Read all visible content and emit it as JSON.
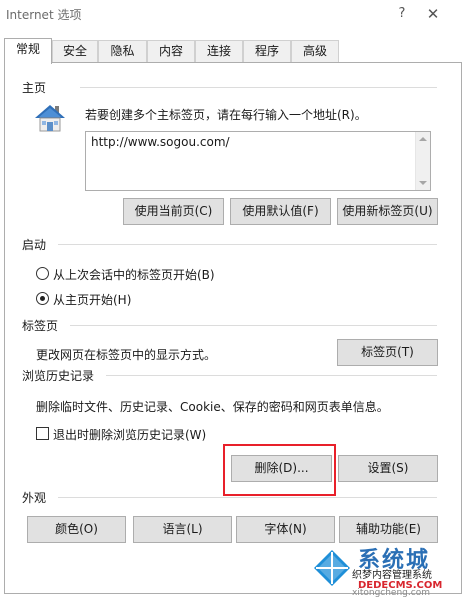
{
  "window": {
    "title": "Internet 选项",
    "help_label": "?",
    "close_label": "✕"
  },
  "tabs": [
    {
      "label": "常规",
      "active": true
    },
    {
      "label": "安全"
    },
    {
      "label": "隐私"
    },
    {
      "label": "内容"
    },
    {
      "label": "连接"
    },
    {
      "label": "程序"
    },
    {
      "label": "高级"
    }
  ],
  "homepage": {
    "section_label": "主页",
    "instruction": "若要创建多个主标签页，请在每行输入一个地址(R)。",
    "url_value": "http://www.sogou.com/",
    "use_current_label": "使用当前页(C)",
    "use_default_label": "使用默认值(F)",
    "use_new_tab_label": "使用新标签页(U)"
  },
  "startup": {
    "section_label": "启动",
    "option_last_session": "从上次会话中的标签页开始(B)",
    "option_home_page": "从主页开始(H)",
    "selected": "option_home_page"
  },
  "tabs_section": {
    "section_label": "标签页",
    "description": "更改网页在标签页中的显示方式。",
    "tabs_button_label": "标签页(T)"
  },
  "history": {
    "section_label": "浏览历史记录",
    "description": "删除临时文件、历史记录、Cookie、保存的密码和网页表单信息。",
    "delete_on_exit_label": "退出时删除浏览历史记录(W)",
    "delete_on_exit_checked": false,
    "delete_button_label": "删除(D)...",
    "settings_button_label": "设置(S)"
  },
  "appearance": {
    "section_label": "外观",
    "colors_label": "颜色(O)",
    "languages_label": "语言(L)",
    "fonts_label": "字体(N)",
    "accessibility_label": "辅助功能(E)"
  },
  "watermark": {
    "brand": "系统城",
    "caption": "织梦内容管理系统",
    "site": "DEDECMS.COM",
    "url": "xitongcheng.com"
  },
  "colors": {
    "highlight_border": "#e8202a",
    "button_face": "#e1e1e1",
    "house_roof": "#2f6fb8"
  }
}
